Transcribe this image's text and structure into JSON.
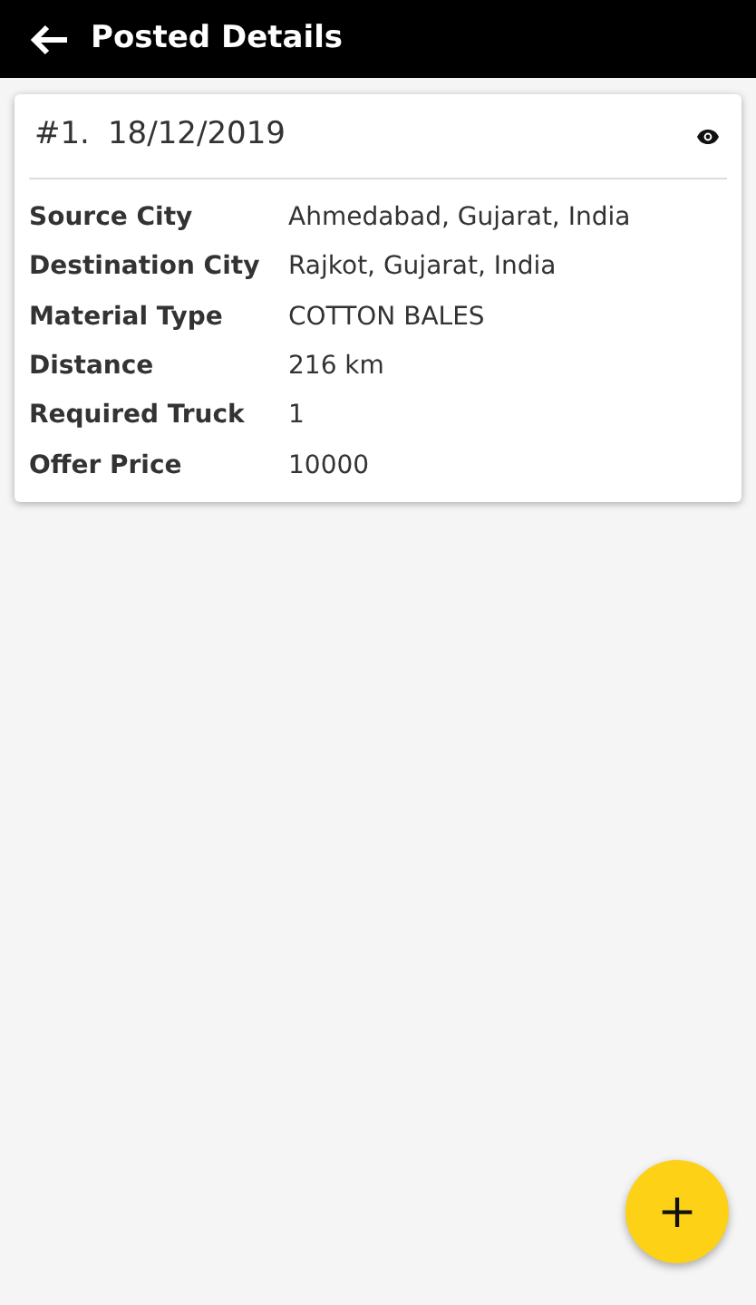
{
  "app_bar": {
    "title": "Posted Details"
  },
  "posts": [
    {
      "number": "#1.",
      "date": "18/12/2019",
      "details": [
        {
          "label": "Source City",
          "value": "Ahmedabad, Gujarat, India"
        },
        {
          "label": "Destination City",
          "value": "Rajkot, Gujarat, India"
        },
        {
          "label": "Material Type",
          "value": "COTTON BALES"
        },
        {
          "label": "Distance",
          "value": "216 km"
        },
        {
          "label": "Required Truck",
          "value": "1"
        },
        {
          "label": "Offer Price",
          "value": "10000"
        }
      ]
    }
  ],
  "fab": {
    "label": "+"
  }
}
